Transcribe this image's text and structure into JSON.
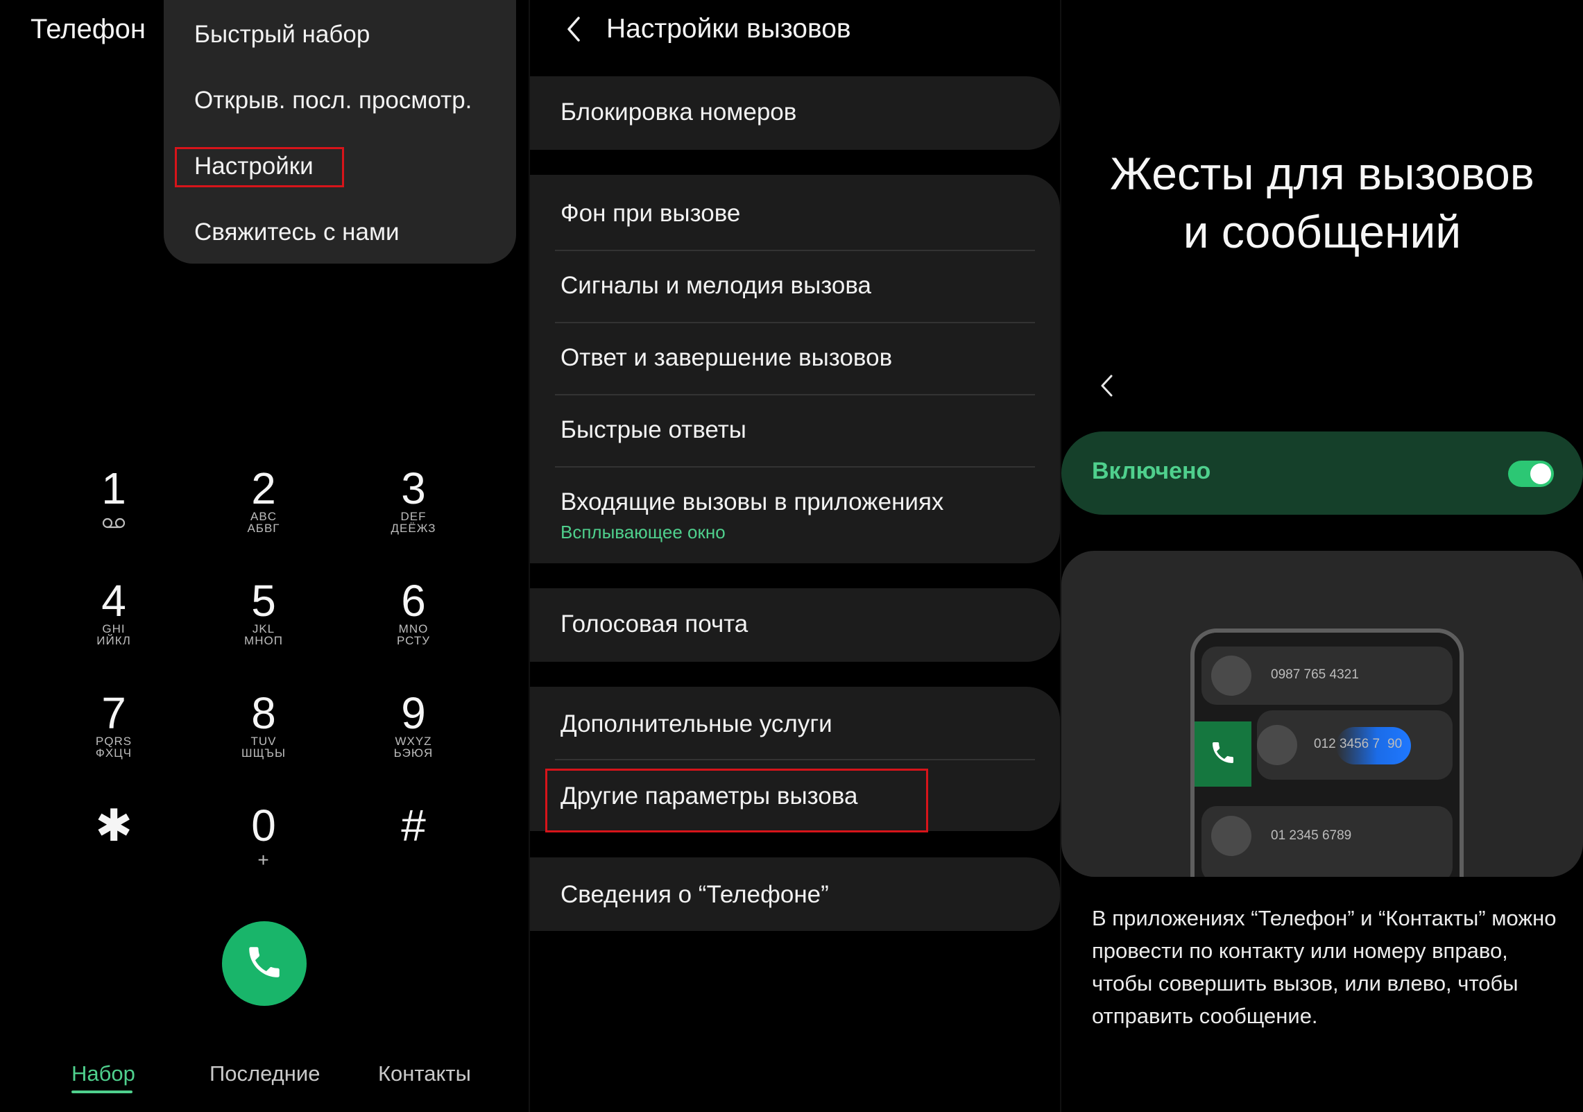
{
  "panel_dialer": {
    "app_title": "Телефон",
    "menu": {
      "items": [
        "Быстрый набор",
        "Открыв. посл. просмотр.",
        "Настройки",
        "Свяжитесь с нами"
      ],
      "highlighted": "Настройки"
    },
    "keypad": [
      {
        "num": "1",
        "sub1": "",
        "sub2": "",
        "icon": "voicemail-icon"
      },
      {
        "num": "2",
        "sub1": "ABC",
        "sub2": "АБВГ"
      },
      {
        "num": "3",
        "sub1": "DEF",
        "sub2": "ДЕЁЖЗ"
      },
      {
        "num": "4",
        "sub1": "GHI",
        "sub2": "ИЙКЛ"
      },
      {
        "num": "5",
        "sub1": "JKL",
        "sub2": "МНОП"
      },
      {
        "num": "6",
        "sub1": "MNO",
        "sub2": "РСТУ"
      },
      {
        "num": "7",
        "sub1": "PQRS",
        "sub2": "ФХЦЧ"
      },
      {
        "num": "8",
        "sub1": "TUV",
        "sub2": "ШЩЪЫ"
      },
      {
        "num": "9",
        "sub1": "WXYZ",
        "sub2": "ЬЭЮЯ"
      },
      {
        "num": "✱",
        "sub1": "",
        "sub2": ""
      },
      {
        "num": "0",
        "sub1": "+",
        "sub2": ""
      },
      {
        "num": "#",
        "sub1": "",
        "sub2": ""
      }
    ],
    "call_icon": "phone-icon",
    "tabs": [
      {
        "label": "Набор",
        "active": true
      },
      {
        "label": "Последние",
        "active": false
      },
      {
        "label": "Контакты",
        "active": false
      }
    ]
  },
  "panel_settings": {
    "header": "Настройки вызовов",
    "back_icon": "chevron-left-icon",
    "groups": [
      {
        "rows": [
          {
            "label": "Блокировка номеров"
          }
        ]
      },
      {
        "rows": [
          {
            "label": "Фон при вызове"
          },
          {
            "label": "Сигналы и мелодия вызова"
          },
          {
            "label": "Ответ и завершение вызовов"
          },
          {
            "label": "Быстрые ответы"
          },
          {
            "label": "Входящие вызовы в приложениях",
            "sub": "Всплывающее окно"
          }
        ]
      },
      {
        "rows": [
          {
            "label": "Голосовая почта"
          }
        ]
      },
      {
        "rows": [
          {
            "label": "Дополнительные услуги"
          },
          {
            "label": "Другие параметры вызова",
            "highlighted": true
          }
        ]
      },
      {
        "rows": [
          {
            "label": "Сведения о “Телефоне”"
          }
        ]
      }
    ]
  },
  "panel_gestures": {
    "title_line1": "Жесты для вызовов",
    "title_line2": "и сообщений",
    "back_icon": "chevron-left-icon",
    "toggle": {
      "label": "Включено",
      "on": true
    },
    "illustration": {
      "numbers": [
        "0987 765 4321",
        "012 3456 7890",
        "01 2345 6789"
      ],
      "number2_visible_left": "012 3456 7",
      "number2_visible_right": "90"
    },
    "description": "В приложениях “Телефон” и “Контакты” можно провести по контакту или номеру вправо, чтобы совершить вызов, или влево, чтобы отправить сообщение."
  },
  "colors": {
    "accent_green": "#4fd08d",
    "call_green": "#19b56a",
    "highlight_red": "#d7141a",
    "card_bg": "#1c1c1c",
    "toggle_card_bg": "#15402a"
  }
}
